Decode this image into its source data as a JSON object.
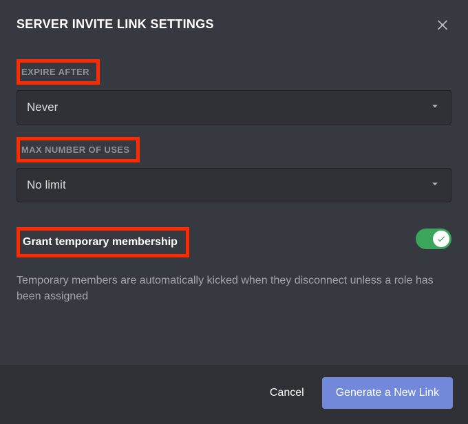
{
  "header": {
    "title": "SERVER INVITE LINK SETTINGS"
  },
  "expire": {
    "label": "EXPIRE AFTER",
    "value": "Never"
  },
  "maxUses": {
    "label": "MAX NUMBER OF USES",
    "value": "No limit"
  },
  "tempMembership": {
    "label": "Grant temporary membership",
    "help": "Temporary members are automatically kicked when they disconnect unless a role has been assigned",
    "enabled": true
  },
  "footer": {
    "cancel": "Cancel",
    "generate": "Generate a New Link"
  }
}
